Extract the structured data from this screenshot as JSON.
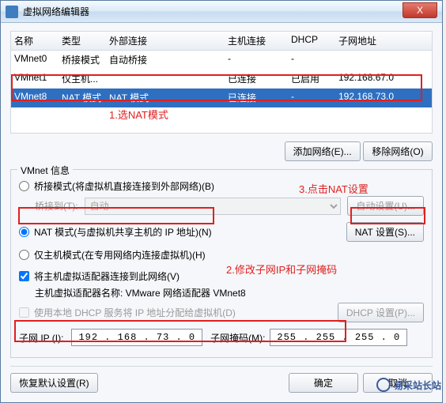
{
  "window": {
    "title": "虚拟网络编辑器"
  },
  "table": {
    "headers": {
      "name": "名称",
      "type": "类型",
      "ext": "外部连接",
      "host": "主机连接",
      "dhcp": "DHCP",
      "ip": "子网地址"
    },
    "rows": [
      {
        "name": "VMnet0",
        "type": "桥接模式",
        "ext": "自动桥接",
        "host": "-",
        "dhcp": "-",
        "ip": ""
      },
      {
        "name": "VMnet1",
        "type": "仅主机...",
        "ext": "",
        "host": "已连接",
        "dhcp": "已启用",
        "ip": "192.168.67.0"
      },
      {
        "name": "VMnet8",
        "type": "NAT 模式",
        "ext": "NAT 模式",
        "host": "已连接",
        "dhcp": "-",
        "ip": "192.168.73.0"
      }
    ]
  },
  "annotations": {
    "a1": "1.选NAT模式",
    "a2": "2.修改子网IP和子网掩码",
    "a3": "3.点击NAT设置"
  },
  "buttons": {
    "addNet": "添加网络(E)...",
    "removeNet": "移除网络(O)",
    "autoSet": "自动设置(U)...",
    "natSet": "NAT 设置(S)...",
    "dhcpSet": "DHCP 设置(P)...",
    "restore": "恢复默认设置(R)",
    "ok": "确定",
    "cancel": "取消",
    "close": "X"
  },
  "fieldset": {
    "legend": "VMnet 信息",
    "bridge": "桥接模式(将虚拟机直接连接到外部网络)(B)",
    "bridgeTo": "桥接到(T):",
    "bridgeSel": "自动",
    "nat": "NAT 模式(与虚拟机共享主机的 IP 地址)(N)",
    "hostOnly": "仅主机模式(在专用网络内连接虚拟机)(H)",
    "connectHost": "将主机虚拟适配器连接到此网络(V)",
    "adapterName": "主机虚拟适配器名称: VMware 网络适配器 VMnet8",
    "useDhcp": "使用本地 DHCP 服务将 IP 地址分配给虚拟机(D)",
    "subnetIp": "子网 IP (I):",
    "subnetIpVal": "192 . 168 . 73 . 0",
    "mask": "子网掩码(M):",
    "maskVal": "255 . 255 . 255 . 0"
  },
  "watermark": "易采站长站"
}
